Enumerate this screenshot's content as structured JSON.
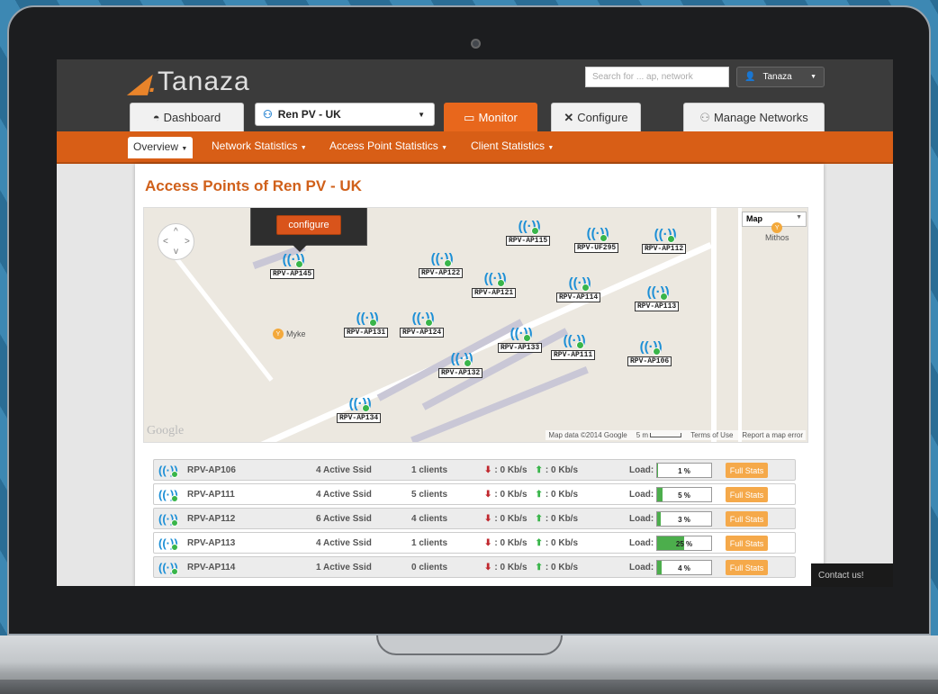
{
  "brand": {
    "name": "Tanaza"
  },
  "search": {
    "placeholder": "Search for ... ap, network"
  },
  "user": {
    "name": "Tanaza"
  },
  "tabs": {
    "dashboard": "Dashboard",
    "network": "Ren PV - UK",
    "monitor": "Monitor",
    "configure": "Configure",
    "manage": "Manage Networks"
  },
  "subnav": {
    "overview": "Overview",
    "network_stats": "Network Statistics",
    "ap_stats": "Access Point Statistics",
    "client_stats": "Client Statistics"
  },
  "page": {
    "title": "Access Points of Ren PV - UK"
  },
  "map": {
    "configure_label": "configure",
    "map_type": "Map",
    "poi": [
      "Myke",
      "Mithos"
    ],
    "google": "Google",
    "attribution": "Map data ©2014 Google",
    "scale": "5 m",
    "terms": "Terms of Use",
    "report": "Report a map error",
    "aps": [
      "RPV-AP145",
      "RPV-AP115",
      "RPV-UF295",
      "RPV-AP112",
      "RPV-AP122",
      "RPV-AP121",
      "RPV-AP114",
      "RPV-AP113",
      "RPV-AP131",
      "RPV-AP124",
      "RPV-AP133",
      "RPV-AP111",
      "RPV-AP106",
      "RPV-AP132",
      "RPV-AP134"
    ]
  },
  "rows": [
    {
      "name": "RPV-AP106",
      "ssid": "4 Active Ssid",
      "clients": "1 clients",
      "down": ": 0 Kb/s",
      "up": ": 0 Kb/s",
      "load_label": "Load:",
      "load": "1 %",
      "load_value": 1,
      "action": "Full Stats"
    },
    {
      "name": "RPV-AP111",
      "ssid": "4 Active Ssid",
      "clients": "5 clients",
      "down": ": 0 Kb/s",
      "up": ": 0 Kb/s",
      "load_label": "Load:",
      "load": "5 %",
      "load_value": 5,
      "action": "Full Stats"
    },
    {
      "name": "RPV-AP112",
      "ssid": "6 Active Ssid",
      "clients": "4 clients",
      "down": ": 0 Kb/s",
      "up": ": 0 Kb/s",
      "load_label": "Load:",
      "load": "3 %",
      "load_value": 3,
      "action": "Full Stats"
    },
    {
      "name": "RPV-AP113",
      "ssid": "4 Active Ssid",
      "clients": "1 clients",
      "down": ": 0 Kb/s",
      "up": ": 0 Kb/s",
      "load_label": "Load:",
      "load": "25 %",
      "load_value": 25,
      "action": "Full Stats"
    },
    {
      "name": "RPV-AP114",
      "ssid": "1 Active Ssid",
      "clients": "0 clients",
      "down": ": 0 Kb/s",
      "up": ": 0 Kb/s",
      "load_label": "Load:",
      "load": "4 %",
      "load_value": 4,
      "action": "Full Stats"
    }
  ],
  "contact": {
    "label": "Contact us!"
  },
  "colors": {
    "accent": "#d85e16",
    "title": "#d0601a",
    "ap_icon": "#1c8fd6",
    "ok": "#39b54a",
    "full_stats": "#f5a94a"
  }
}
